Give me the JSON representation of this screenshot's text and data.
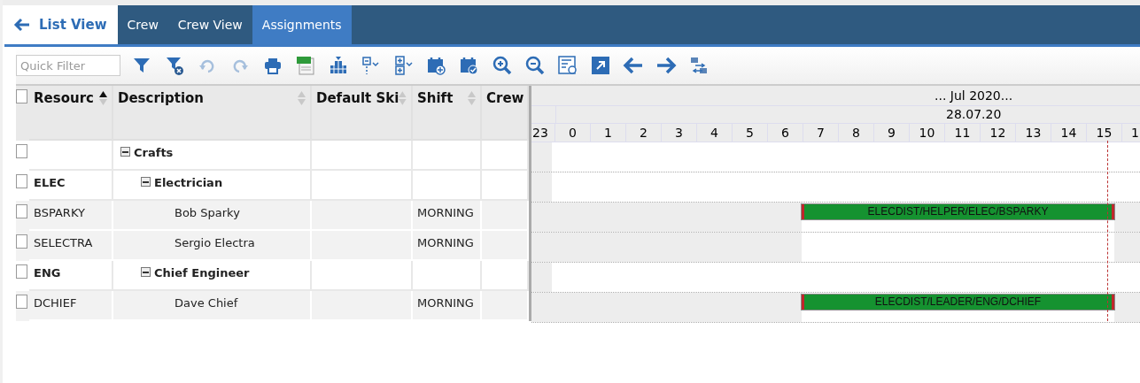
{
  "tabs": [
    {
      "label": "List View",
      "kind": "back",
      "selected": false
    },
    {
      "label": "Crew",
      "kind": "tab",
      "selected": false
    },
    {
      "label": "Crew View",
      "kind": "tab",
      "selected": false
    },
    {
      "label": "Assignments",
      "kind": "tab",
      "selected": true
    }
  ],
  "toolbar": {
    "quick_filter": {
      "placeholder": "Quick Filter"
    },
    "tools": [
      {
        "kind": "filter",
        "disabled": false
      },
      {
        "kind": "filter-clear",
        "disabled": false
      },
      {
        "kind": "undo",
        "disabled": true
      },
      {
        "kind": "redo",
        "disabled": true
      },
      {
        "kind": "print",
        "disabled": false
      },
      {
        "kind": "excel",
        "disabled": false
      },
      {
        "kind": "hierarchy",
        "disabled": false
      },
      {
        "kind": "collapse",
        "disabled": false
      },
      {
        "kind": "expand",
        "disabled": false
      },
      {
        "kind": "calendar-add",
        "disabled": false
      },
      {
        "kind": "calendar-check",
        "disabled": false
      },
      {
        "kind": "zoom-in",
        "disabled": false
      },
      {
        "kind": "zoom-out",
        "disabled": false
      },
      {
        "kind": "fit",
        "disabled": false
      },
      {
        "kind": "popout",
        "disabled": false
      },
      {
        "kind": "arrow-left",
        "disabled": false
      },
      {
        "kind": "arrow-right",
        "disabled": false
      },
      {
        "kind": "swap",
        "disabled": false
      }
    ]
  },
  "grid": {
    "header_checked": false,
    "columns": [
      {
        "label": "Resourc",
        "sorted": true
      },
      {
        "label": "Description",
        "sorted": false
      },
      {
        "label": "Default Ski",
        "sorted": false
      },
      {
        "label": "Shift",
        "sorted": false
      },
      {
        "label": "Crew"
      }
    ],
    "rows": [
      {
        "kind": "group",
        "checked": false,
        "resource": "",
        "description": "Crafts",
        "expanded": true,
        "children": [
          {
            "kind": "group",
            "checked": false,
            "resource": "ELEC",
            "description": "Electrician",
            "expanded": true,
            "children": [
              {
                "kind": "resource",
                "checked": false,
                "resource": "BSPARKY",
                "description": "Bob Sparky",
                "shift": "MORNING",
                "bar": {
                  "label": "ELECDIST/HELPER/ELEC/BSPARKY"
                }
              },
              {
                "kind": "resource",
                "checked": false,
                "resource": "SELECTRA",
                "description": "Sergio Electra",
                "shift": "MORNING"
              }
            ]
          },
          {
            "kind": "group",
            "checked": false,
            "resource": "ENG",
            "description": "Chief Engineer",
            "expanded": true,
            "children": [
              {
                "kind": "resource",
                "checked": false,
                "resource": "DCHIEF",
                "description": "Dave Chief",
                "shift": "MORNING",
                "bar": {
                  "label": "ELECDIST/LEADER/ENG/DCHIEF"
                }
              }
            ]
          }
        ]
      }
    ]
  },
  "gantt": {
    "month": "... Jul 2020...",
    "day": "28.07.20",
    "hours": [
      "23",
      "0",
      "1",
      "2",
      "3",
      "4",
      "5",
      "6",
      "7",
      "8",
      "9",
      "10",
      "11",
      "12",
      "13",
      "14",
      "15",
      "1"
    ]
  }
}
